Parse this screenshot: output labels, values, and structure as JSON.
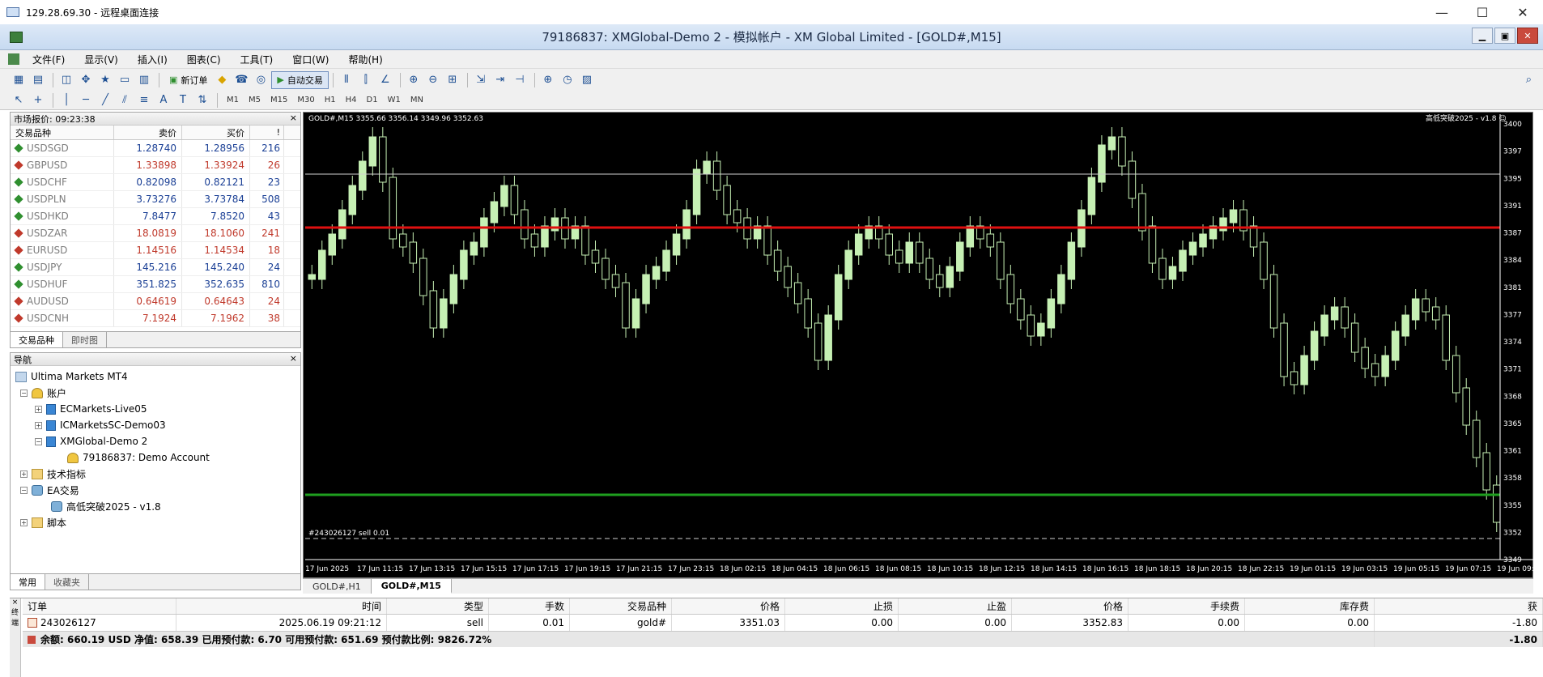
{
  "rdp": {
    "title": "129.28.69.30 - 远程桌面连接",
    "min": "—",
    "max": "☐",
    "close": "✕"
  },
  "app": {
    "title": "79186837: XMGlobal-Demo 2 - 模拟帐户 - XM Global Limited - [GOLD#,M15]"
  },
  "menu": [
    "文件(F)",
    "显示(V)",
    "插入(I)",
    "图表(C)",
    "工具(T)",
    "窗口(W)",
    "帮助(H)"
  ],
  "toolbar": {
    "new_order": "新订单",
    "auto_trade": "自动交易",
    "timeframes": [
      "M1",
      "M5",
      "M15",
      "M30",
      "H1",
      "H4",
      "D1",
      "W1",
      "MN"
    ]
  },
  "market_watch": {
    "title": "市场报价: 09:23:38",
    "columns": [
      "交易品种",
      "卖价",
      "买价",
      "!"
    ],
    "rows": [
      {
        "symbol": "USDSGD",
        "bid": "1.28740",
        "ask": "1.28956",
        "spread": "216",
        "dir": "up"
      },
      {
        "symbol": "GBPUSD",
        "bid": "1.33898",
        "ask": "1.33924",
        "spread": "26",
        "dir": "dn"
      },
      {
        "symbol": "USDCHF",
        "bid": "0.82098",
        "ask": "0.82121",
        "spread": "23",
        "dir": "up"
      },
      {
        "symbol": "USDPLN",
        "bid": "3.73276",
        "ask": "3.73784",
        "spread": "508",
        "dir": "up"
      },
      {
        "symbol": "USDHKD",
        "bid": "7.8477",
        "ask": "7.8520",
        "spread": "43",
        "dir": "up"
      },
      {
        "symbol": "USDZAR",
        "bid": "18.0819",
        "ask": "18.1060",
        "spread": "241",
        "dir": "dn"
      },
      {
        "symbol": "EURUSD",
        "bid": "1.14516",
        "ask": "1.14534",
        "spread": "18",
        "dir": "dn"
      },
      {
        "symbol": "USDJPY",
        "bid": "145.216",
        "ask": "145.240",
        "spread": "24",
        "dir": "up"
      },
      {
        "symbol": "USDHUF",
        "bid": "351.825",
        "ask": "352.635",
        "spread": "810",
        "dir": "up"
      },
      {
        "symbol": "AUDUSD",
        "bid": "0.64619",
        "ask": "0.64643",
        "spread": "24",
        "dir": "dn"
      },
      {
        "symbol": "USDCNH",
        "bid": "7.1924",
        "ask": "7.1962",
        "spread": "38",
        "dir": "dn"
      }
    ],
    "tabs": [
      "交易品种",
      "即时图"
    ]
  },
  "navigator": {
    "title": "导航",
    "root": "Ultima Markets MT4",
    "accounts": "账户",
    "account_list": [
      "ECMarkets-Live05",
      "ICMarketsSC-Demo03",
      "XMGlobal-Demo 2"
    ],
    "demo_account": "79186837: Demo Account",
    "indicators": "技术指标",
    "experts": "EA交易",
    "expert_name": "高低突破2025 - v1.8",
    "scripts": "脚本",
    "tabs": [
      "常用",
      "收藏夹"
    ]
  },
  "chart": {
    "symbol_info": "GOLD#,M15  3355.66 3356.14 3349.96 3352.63",
    "ea_label": "高低突破2025 - v1.8 ☺",
    "order_label": "#243026127 sell 0.01",
    "price_ticks": [
      "3400",
      "3397",
      "3395",
      "3391",
      "3387",
      "3384",
      "3381",
      "3377",
      "3374",
      "3371",
      "3368",
      "3365",
      "3361",
      "3358",
      "3355",
      "3352",
      "3349"
    ],
    "time_ticks": [
      "17 Jun 2025",
      "17 Jun 11:15",
      "17 Jun 13:15",
      "17 Jun 15:15",
      "17 Jun 17:15",
      "17 Jun 19:15",
      "17 Jun 21:15",
      "17 Jun 23:15",
      "18 Jun 02:15",
      "18 Jun 04:15",
      "18 Jun 06:15",
      "18 Jun 08:15",
      "18 Jun 10:15",
      "18 Jun 12:15",
      "18 Jun 14:15",
      "18 Jun 16:15",
      "18 Jun 18:15",
      "18 Jun 20:15",
      "18 Jun 22:15",
      "19 Jun 01:15",
      "19 Jun 03:15",
      "19 Jun 05:15",
      "19 Jun 07:15",
      "19 Jun 09:"
    ],
    "tabs": [
      "GOLD#,H1",
      "GOLD#,M15"
    ],
    "colors": {
      "candle": "#c6f0b4",
      "red_line": "#e01010",
      "green_line": "#1f9f1f",
      "white_line": "#d0d0d0"
    }
  },
  "terminal": {
    "columns": [
      "订单",
      "时间",
      "类型",
      "手数",
      "交易品种",
      "价格",
      "止损",
      "止盈",
      "价格",
      "手续费",
      "库存费",
      "获"
    ],
    "order": {
      "id": "243026127",
      "time": "2025.06.19 09:21:12",
      "type": "sell",
      "lots": "0.01",
      "symbol": "gold#",
      "open_price": "3351.03",
      "sl": "0.00",
      "tp": "0.00",
      "price": "3352.83",
      "commission": "0.00",
      "swap": "0.00",
      "profit": "-1.80"
    },
    "balance_line": "余额: 660.19 USD  净值: 658.39  已用预付款: 6.70  可用预付款: 651.69  预付款比例: 9826.72%",
    "balance_profit": "-1.80",
    "side_label": "× 终端"
  }
}
